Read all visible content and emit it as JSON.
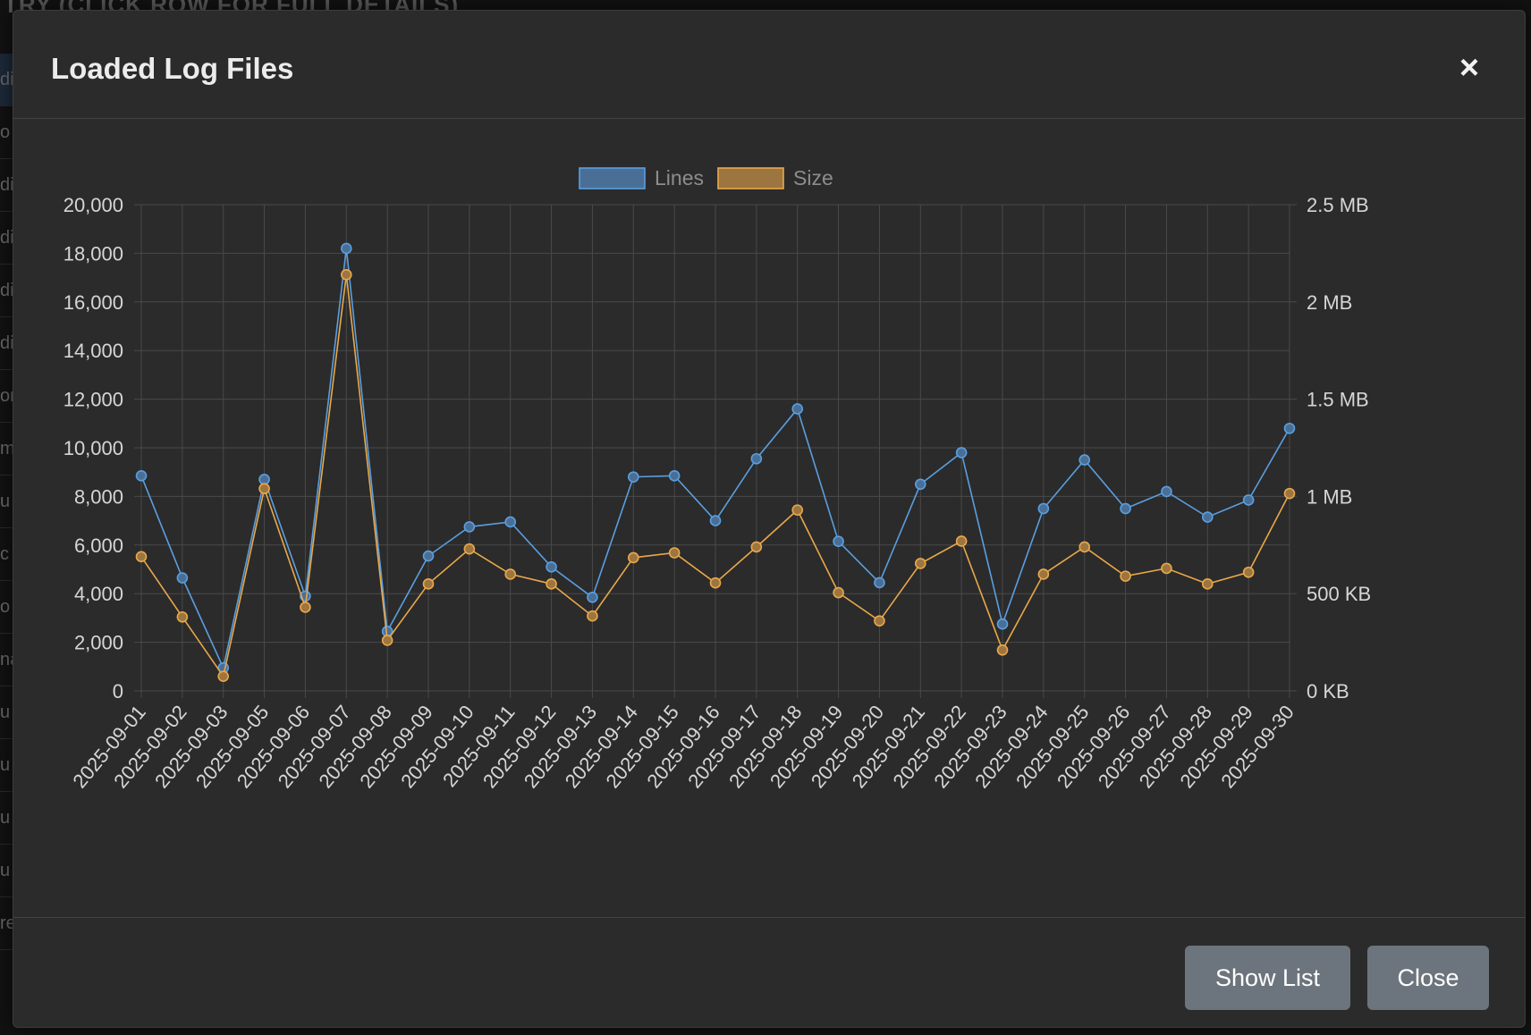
{
  "background": {
    "heading": "TRY (CLICK ROW FOR FULL DETAILS)",
    "row_fragments": [
      "di",
      "o",
      "di",
      "di",
      "di",
      "di",
      "on",
      "m",
      "u",
      "c",
      "o",
      "na",
      "u",
      "u",
      "u",
      "u",
      "re"
    ]
  },
  "modal": {
    "title": "Loaded Log Files",
    "close_icon": "×",
    "footer": {
      "show_list_label": "Show List",
      "close_label": "Close"
    }
  },
  "colors": {
    "lines": "#5a9fe0",
    "size": "#e9a84a",
    "lines_fill": "#4a6f96",
    "size_fill": "#9d7540",
    "grid": "#4a4a4a",
    "panel": "#2b2b2b"
  },
  "chart_data": {
    "type": "line",
    "legend": [
      "Lines",
      "Size"
    ],
    "legend_position": "top-center",
    "grid": true,
    "categories": [
      "2025-09-01",
      "2025-09-02",
      "2025-09-03",
      "2025-09-05",
      "2025-09-06",
      "2025-09-07",
      "2025-09-08",
      "2025-09-09",
      "2025-09-10",
      "2025-09-11",
      "2025-09-12",
      "2025-09-13",
      "2025-09-14",
      "2025-09-15",
      "2025-09-16",
      "2025-09-17",
      "2025-09-18",
      "2025-09-19",
      "2025-09-20",
      "2025-09-21",
      "2025-09-22",
      "2025-09-23",
      "2025-09-24",
      "2025-09-25",
      "2025-09-26",
      "2025-09-27",
      "2025-09-28",
      "2025-09-29",
      "2025-09-30"
    ],
    "left_axis": {
      "ylim": [
        0,
        20000
      ],
      "ticks": [
        0,
        2000,
        4000,
        6000,
        8000,
        10000,
        12000,
        14000,
        16000,
        18000,
        20000
      ],
      "tick_labels": [
        "0",
        "2,000",
        "4,000",
        "6,000",
        "8,000",
        "10,000",
        "12,000",
        "14,000",
        "16,000",
        "18,000",
        "20,000"
      ]
    },
    "right_axis": {
      "ylim_mb": [
        0,
        2.5
      ],
      "ticks_mb": [
        0,
        0.5,
        1,
        1.5,
        2,
        2.5
      ],
      "tick_labels": [
        "0 KB",
        "500 KB",
        "1 MB",
        "1.5 MB",
        "2 MB",
        "2.5 MB"
      ]
    },
    "series": [
      {
        "name": "Lines",
        "axis": "left",
        "values": [
          8850,
          4650,
          950,
          8700,
          3900,
          18200,
          2450,
          5550,
          6750,
          6950,
          5100,
          3850,
          8800,
          8850,
          7000,
          9550,
          11600,
          6150,
          4450,
          8500,
          9800,
          2750,
          7500,
          9500,
          7500,
          8200,
          7150,
          7850,
          10800
        ]
      },
      {
        "name": "Size",
        "axis": "right",
        "unit": "MB",
        "values": [
          0.69,
          0.38,
          0.075,
          1.04,
          0.43,
          2.14,
          0.26,
          0.55,
          0.73,
          0.6,
          0.55,
          0.385,
          0.685,
          0.71,
          0.555,
          0.74,
          0.93,
          0.505,
          0.36,
          0.655,
          0.77,
          0.21,
          0.6,
          0.74,
          0.59,
          0.63,
          0.55,
          0.61,
          1.015
        ]
      }
    ]
  }
}
